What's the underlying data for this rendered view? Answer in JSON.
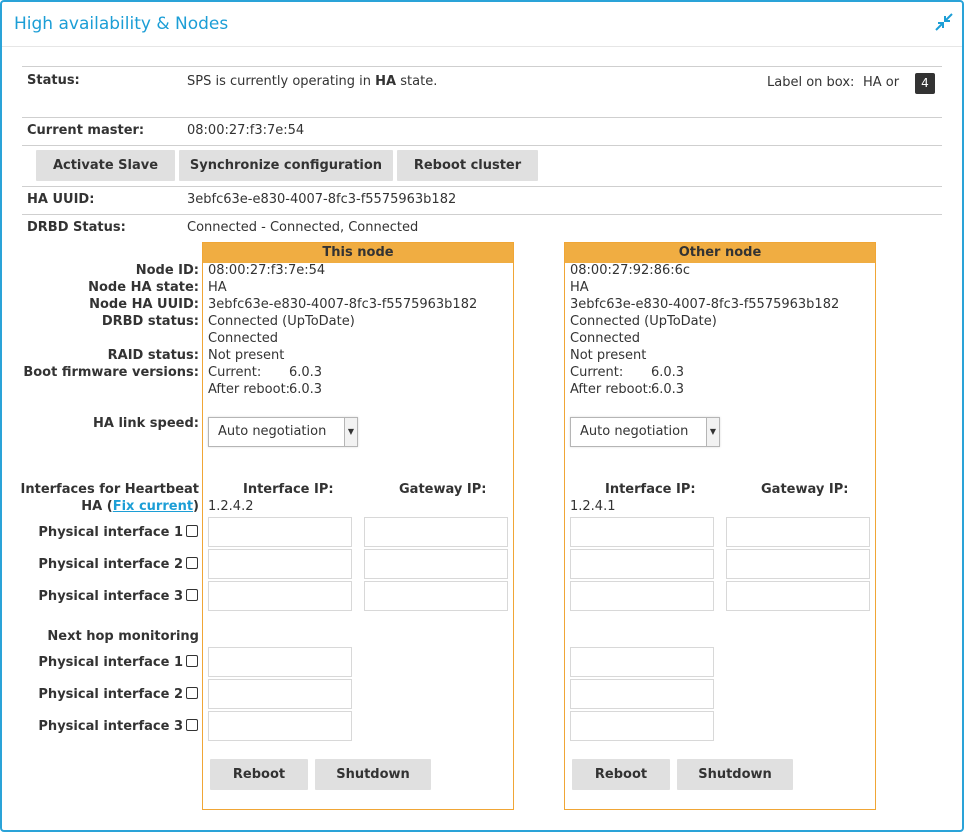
{
  "panel": {
    "title": "High availability & Nodes",
    "collapse_icon": "collapse-icon"
  },
  "status": {
    "label": "Status:",
    "text_before": "SPS is currently operating in ",
    "state": "HA",
    "text_after": " state.",
    "label_on_box": "Label on box:",
    "box_label_text": "HA or",
    "box_number": "4"
  },
  "current_master": {
    "label": "Current master:",
    "value": "08:00:27:f3:7e:54"
  },
  "actions": {
    "activate_slave": "Activate Slave",
    "synchronize": "Synchronize configuration",
    "reboot_cluster": "Reboot cluster"
  },
  "ha_uuid": {
    "label": "HA UUID:",
    "value": "3ebfc63e-e830-4007-8fc3-f5575963b182"
  },
  "drbd_status": {
    "label": "DRBD Status:",
    "value": "Connected - Connected, Connected"
  },
  "row_labels": {
    "node_id": "Node ID:",
    "node_ha_state": "Node HA state:",
    "node_ha_uuid": "Node HA UUID:",
    "drbd_status": "DRBD status:",
    "raid_status": "RAID status:",
    "boot_firmware": "Boot firmware versions:",
    "ha_link_speed": "HA link speed:",
    "interfaces_heartbeat": "Interfaces for Heartbeat",
    "ha_prefix": "HA (",
    "fix_current": "Fix current",
    "ha_suffix": ")",
    "physical_interface_1": "Physical interface 1",
    "physical_interface_2": "Physical interface 2",
    "physical_interface_3": "Physical interface 3",
    "next_hop": "Next hop monitoring"
  },
  "this_node": {
    "header": "This node",
    "node_id": "08:00:27:f3:7e:54",
    "ha_state": "HA",
    "ha_uuid": "3ebfc63e-e830-4007-8fc3-f5575963b182",
    "drbd_status": "Connected (UpToDate)",
    "drbd_status_2": "Connected",
    "raid_status": "Not present",
    "fw_current_label": "Current:",
    "fw_current": "6.0.3",
    "fw_after_label": "After reboot:",
    "fw_after": "6.0.3",
    "link_speed": "Auto negotiation",
    "interface_ip_label": "Interface IP:",
    "gateway_ip_label": "Gateway IP:",
    "ha_ip": "1.2.4.2",
    "reboot": "Reboot",
    "shutdown": "Shutdown"
  },
  "other_node": {
    "header": "Other node",
    "node_id": "08:00:27:92:86:6c",
    "ha_state": "HA",
    "ha_uuid": "3ebfc63e-e830-4007-8fc3-f5575963b182",
    "drbd_status": "Connected (UpToDate)",
    "drbd_status_2": "Connected",
    "raid_status": "Not present",
    "fw_current_label": "Current:",
    "fw_current": "6.0.3",
    "fw_after_label": "After reboot:",
    "fw_after": "6.0.3",
    "link_speed": "Auto negotiation",
    "interface_ip_label": "Interface IP:",
    "gateway_ip_label": "Gateway IP:",
    "ha_ip": "1.2.4.1",
    "reboot": "Reboot",
    "shutdown": "Shutdown"
  },
  "colors": {
    "accent": "#1c9ed6",
    "node_border": "#f0a636",
    "node_header": "#f0ad42"
  }
}
